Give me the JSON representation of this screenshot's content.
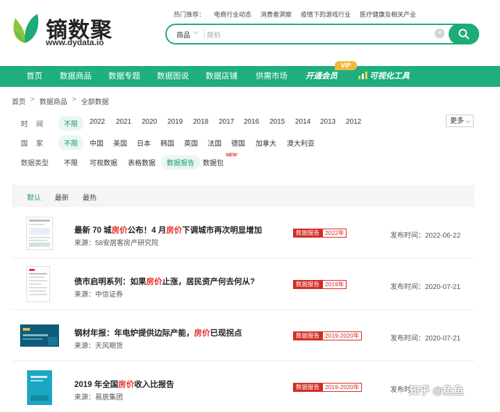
{
  "brand": {
    "name": "镝数聚",
    "url": "www.dydata.io"
  },
  "hot": {
    "label": "热门推荐：",
    "items": [
      "电商行业动态",
      "消费者洞察",
      "疫情下的游戏行业",
      "医疗健康及相关产业"
    ]
  },
  "search": {
    "category": "商品",
    "value": "房价",
    "clear_symbol": "×"
  },
  "nav": {
    "items": [
      "首页",
      "数据商品",
      "数据专题",
      "数据图说",
      "数据店铺",
      "供需市场"
    ],
    "member": "开通会员",
    "vip_badge": "VIP",
    "viz_tool": "可视化工具"
  },
  "breadcrumb": [
    "首页",
    "数据商品",
    "全部数据"
  ],
  "filters": {
    "time": {
      "label": "时　间",
      "options": [
        "不限",
        "2022",
        "2021",
        "2020",
        "2019",
        "2018",
        "2017",
        "2016",
        "2015",
        "2014",
        "2013",
        "2012"
      ],
      "selected": "不限"
    },
    "country": {
      "label": "国　家",
      "options": [
        "不限",
        "中国",
        "美国",
        "日本",
        "韩国",
        "英国",
        "法国",
        "德国",
        "加拿大",
        "澳大利亚"
      ],
      "selected": "不限"
    },
    "type": {
      "label": "数据类型",
      "options": [
        "不限",
        "可视数据",
        "表格数据",
        "数据报告",
        "数据包"
      ],
      "selected": "数据报告",
      "new_badge": "NEW"
    },
    "more": "更多"
  },
  "sort": {
    "options": [
      "默认",
      "最新",
      "最热"
    ],
    "selected": "默认"
  },
  "results": [
    {
      "title_parts": [
        "最新 70 城",
        "房价",
        "公布！4 月",
        "房价",
        "下调城市再次明显增加"
      ],
      "source": "来源：58安居客房产研究院",
      "tag": "数据报告",
      "year": "2022年",
      "date": "发布时间：2022-06-22"
    },
    {
      "title_parts": [
        "债市启明系列：如果",
        "房价",
        "止涨，居民资产何去何从?"
      ],
      "source": "来源：中信证券",
      "tag": "数据报告",
      "year": "2019年",
      "date": "发布时间：2020-07-21"
    },
    {
      "title_parts": [
        "钢材年报：年电炉提供边际产能，",
        "房价",
        "已现拐点"
      ],
      "source": "来源：天风期货",
      "tag": "数据报告",
      "year": "2019-2020年",
      "date": "发布时间：2020-07-21"
    },
    {
      "title_parts": [
        "2019 年全国",
        "房价",
        "收入比报告"
      ],
      "source": "来源：易居集团",
      "tag": "数据报告",
      "year": "2019-2020年",
      "date": "发布时"
    }
  ],
  "watermark": "知乎 @鱼鱼",
  "colors": {
    "brand_green": "#1dab77",
    "nav_green": "#1fae7d",
    "highlight_red": "#e5322d",
    "vip_gold": "#f0b93a"
  }
}
